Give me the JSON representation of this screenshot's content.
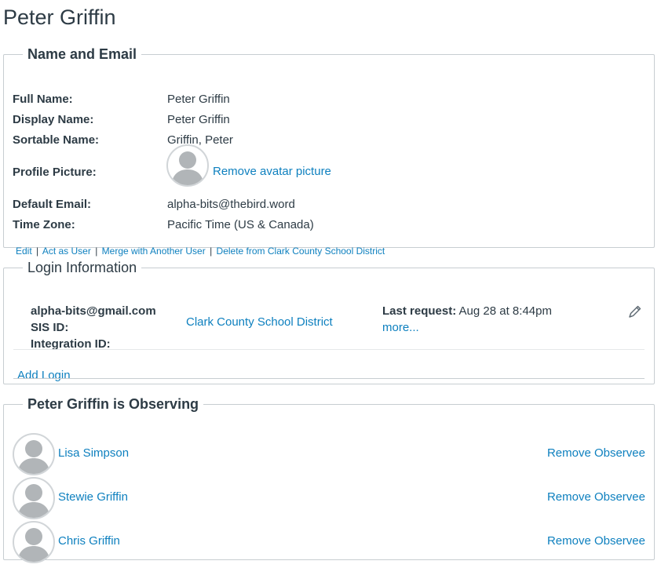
{
  "page": {
    "title": "Peter Griffin"
  },
  "name_email": {
    "legend": "Name and Email",
    "full_name_label": "Full Name:",
    "full_name": "Peter Griffin",
    "display_name_label": "Display Name:",
    "display_name": "Peter Griffin",
    "sortable_name_label": "Sortable Name:",
    "sortable_name": "Griffin, Peter",
    "profile_picture_label": "Profile Picture:",
    "remove_avatar": "Remove avatar picture",
    "default_email_label": "Default Email:",
    "default_email": "alpha-bits@thebird.word",
    "time_zone_label": "Time Zone:",
    "time_zone": "Pacific Time (US & Canada)",
    "actions": {
      "edit": "Edit",
      "act_as_user": "Act as User",
      "merge": "Merge with Another User",
      "delete": "Delete from Clark County School District",
      "separator": "|"
    }
  },
  "login": {
    "legend": "Login Information",
    "login_id": "alpha-bits@gmail.com",
    "sis_id_label": "SIS ID:",
    "integration_id_label": "Integration ID:",
    "account": "Clark County School District",
    "last_request_label": "Last request:",
    "last_request_value": "Aug 28 at 8:44pm",
    "more": "more...",
    "edit_icon": "pencil-icon",
    "add_login": "Add Login"
  },
  "observing": {
    "legend": "Peter Griffin is Observing",
    "avatar_icon": "default-avatar-icon",
    "observees": [
      {
        "name": "Lisa Simpson",
        "remove": "Remove Observee"
      },
      {
        "name": "Stewie Griffin",
        "remove": "Remove Observee"
      },
      {
        "name": "Chris Griffin",
        "remove": "Remove Observee"
      }
    ]
  },
  "colors": {
    "link": "#0e80bf",
    "text": "#2d3b45",
    "border": "#c7cdd1",
    "avatar_silhouette": "#b1b5b8"
  }
}
